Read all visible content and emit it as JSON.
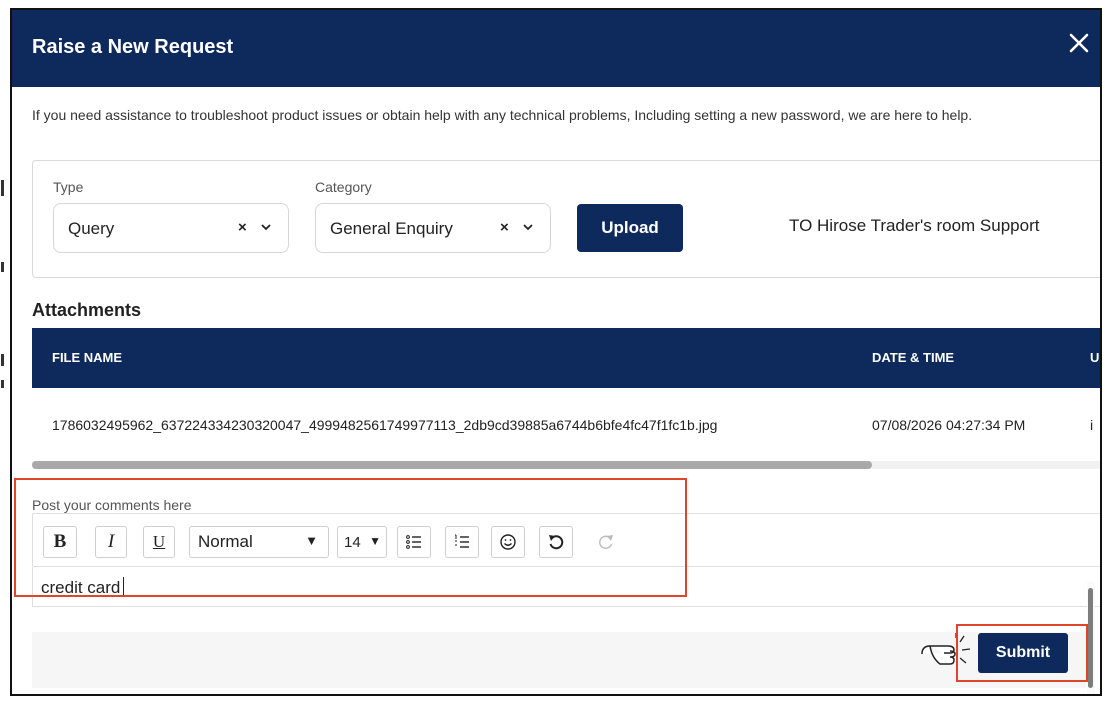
{
  "modal": {
    "title": "Raise a New Request",
    "close_icon": "close-icon",
    "intro": "If you need assistance to troubleshoot product issues or obtain help with any technical problems, Including setting a new password, we are here to help."
  },
  "form": {
    "type_label": "Type",
    "type_value": "Query",
    "category_label": "Category",
    "category_value": "General Enquiry",
    "clear_glyph": "×",
    "upload_label": "Upload",
    "support_text": "TO Hirose Trader's room Support"
  },
  "attachments": {
    "title": "Attachments",
    "columns": [
      "FILE NAME",
      "DATE & TIME",
      "U"
    ],
    "rows": [
      {
        "file_name": "1786032495962_637224334230320047_4999482561749977113_2db9cd39885a6744b6bfe4fc47f1fc1b.jpg",
        "date_time": "07/08/2026 04:27:34 PM",
        "extra": "i"
      }
    ]
  },
  "comment": {
    "placeholder_label": "Post your comments here",
    "toolbar": {
      "bold": "B",
      "italic": "I",
      "underline": "U",
      "format_value": "Normal",
      "size_value": "14",
      "icons": [
        "bullet-list-icon",
        "numbered-list-icon",
        "emoji-icon",
        "undo-icon",
        "redo-icon"
      ]
    },
    "text": "credit card"
  },
  "footer": {
    "submit_label": "Submit"
  },
  "colors": {
    "primary": "#0e2a5c",
    "highlight": "#e0452b"
  }
}
